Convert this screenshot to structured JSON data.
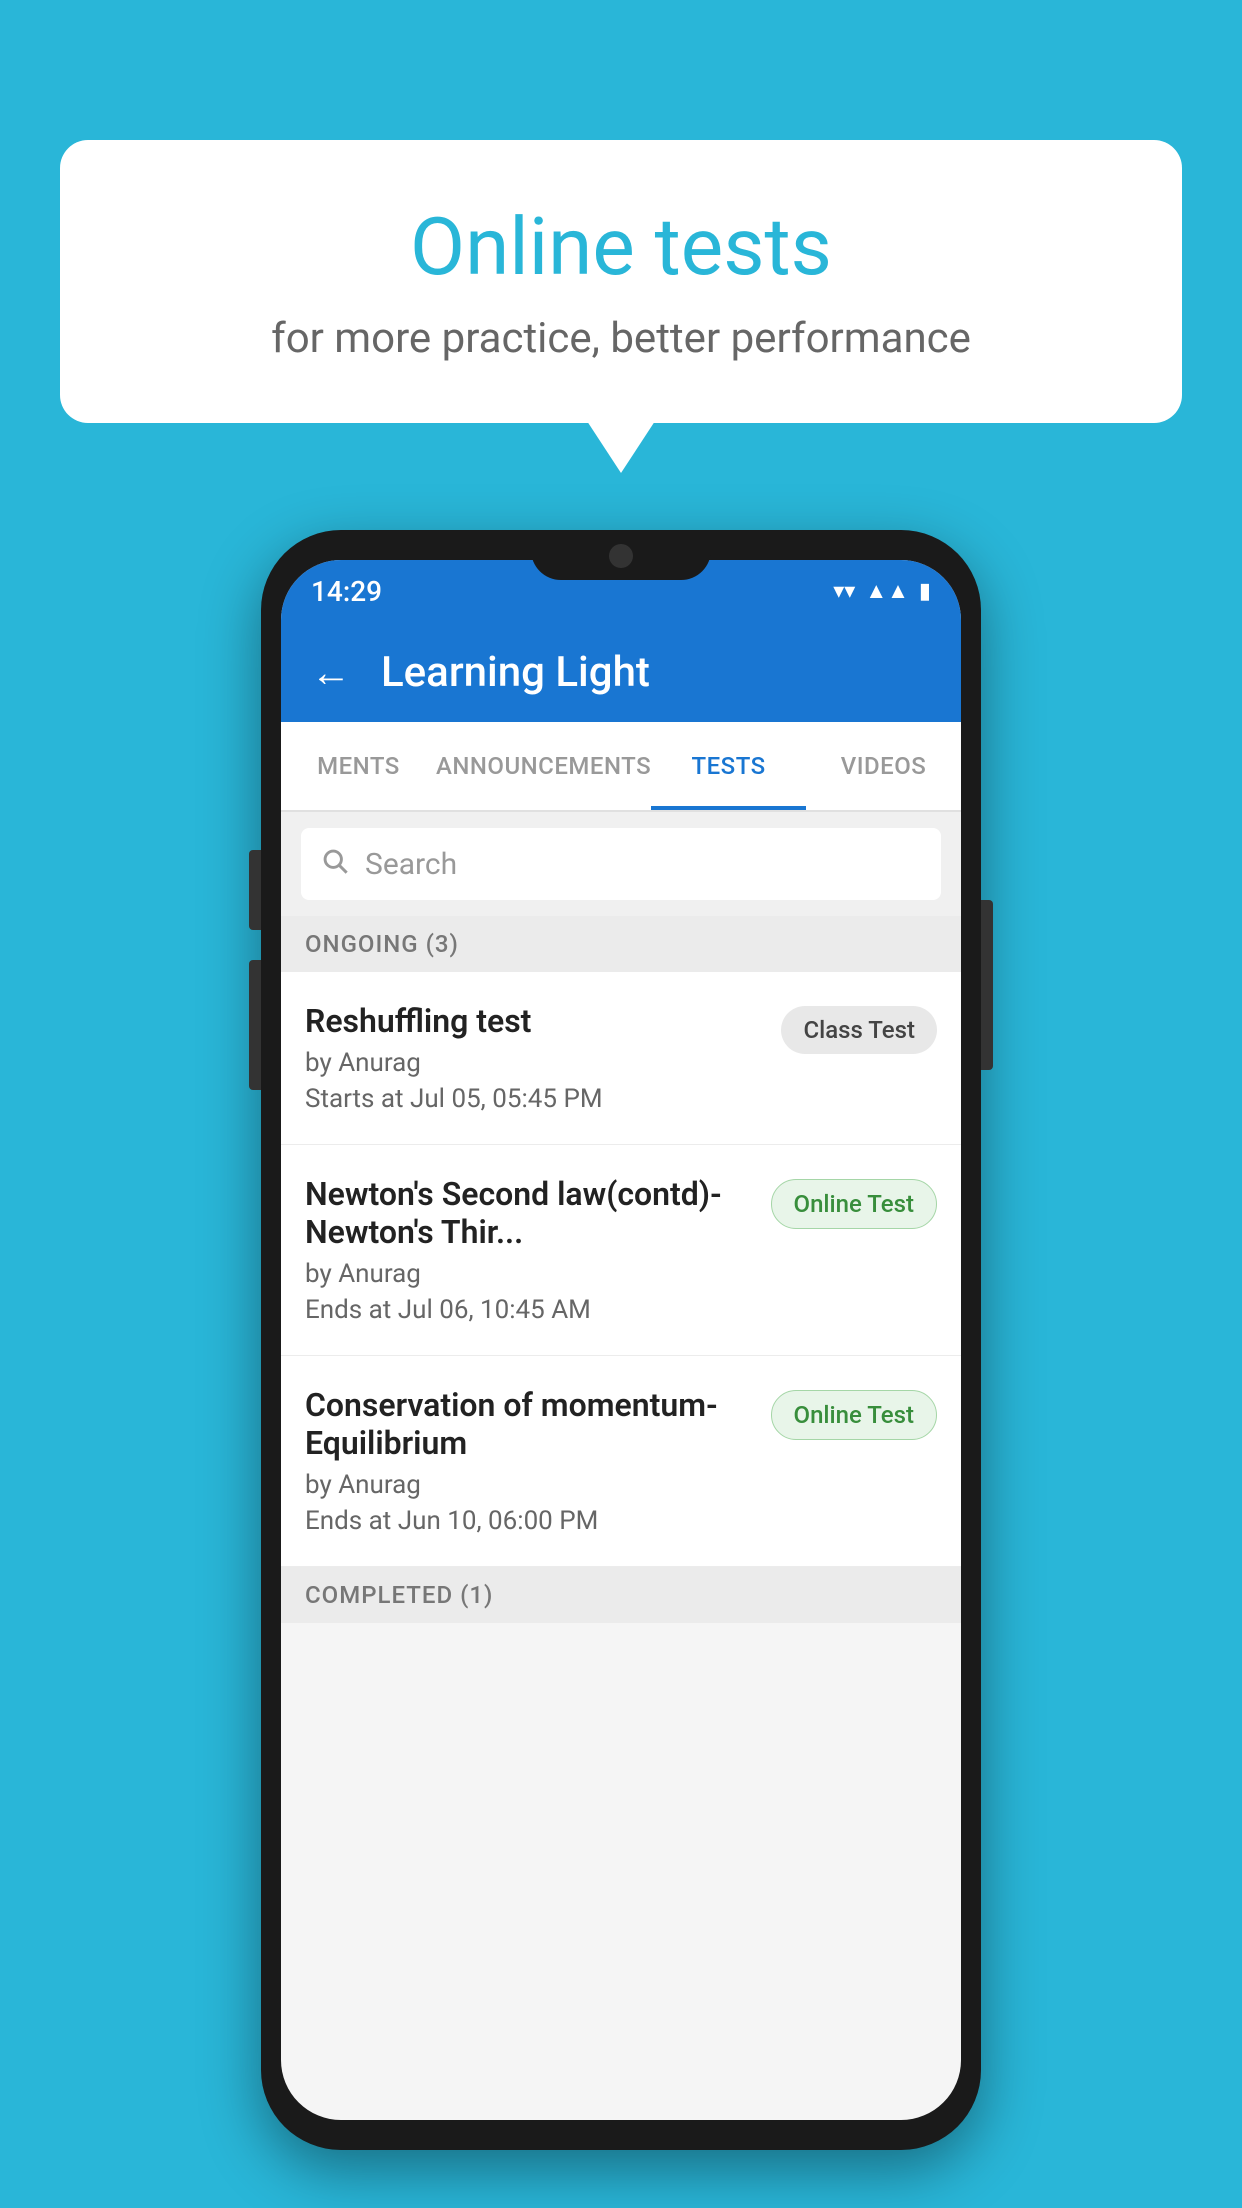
{
  "background": {
    "color": "#29b6d8"
  },
  "speech_bubble": {
    "title": "Online tests",
    "subtitle": "for more practice, better performance"
  },
  "phone": {
    "status_bar": {
      "time": "14:29",
      "wifi": "▼",
      "signal": "▲",
      "battery": "▮"
    },
    "header": {
      "back_label": "←",
      "title": "Learning Light"
    },
    "tabs": [
      {
        "label": "MENTS",
        "active": false
      },
      {
        "label": "ANNOUNCEMENTS",
        "active": false
      },
      {
        "label": "TESTS",
        "active": true
      },
      {
        "label": "VIDEOS",
        "active": false
      }
    ],
    "search": {
      "placeholder": "Search"
    },
    "sections": [
      {
        "label": "ONGOING (3)",
        "items": [
          {
            "name": "Reshuffling test",
            "author": "by Anurag",
            "date": "Starts at  Jul 05, 05:45 PM",
            "badge": "Class Test",
            "badge_type": "class"
          },
          {
            "name": "Newton's Second law(contd)-Newton's Thir...",
            "author": "by Anurag",
            "date": "Ends at  Jul 06, 10:45 AM",
            "badge": "Online Test",
            "badge_type": "online"
          },
          {
            "name": "Conservation of momentum-Equilibrium",
            "author": "by Anurag",
            "date": "Ends at  Jun 10, 06:00 PM",
            "badge": "Online Test",
            "badge_type": "online"
          }
        ]
      },
      {
        "label": "COMPLETED (1)",
        "items": []
      }
    ]
  }
}
